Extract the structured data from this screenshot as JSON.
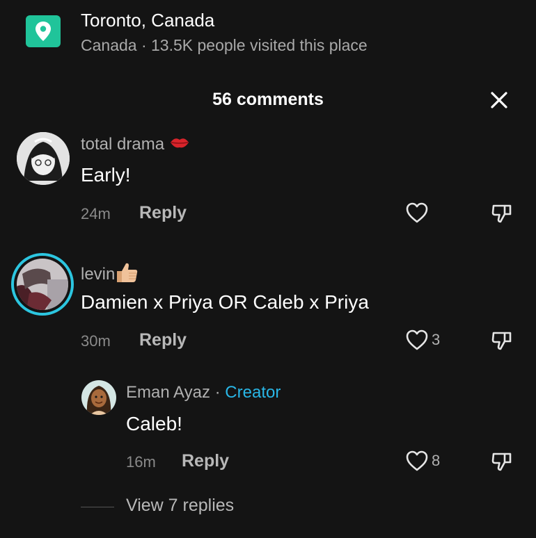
{
  "location": {
    "title": "Toronto, Canada",
    "subtitle": "Canada · 13.5K people visited this place",
    "icon": "map-pin-icon",
    "icon_color": "#20c49a"
  },
  "header": {
    "comments_count": "56 comments",
    "close_icon": "close-icon"
  },
  "comments": [
    {
      "username": "total drama",
      "emoji": "lips-emoji",
      "text": "Early!",
      "time": "24m",
      "reply_label": "Reply",
      "likes": ""
    },
    {
      "username": "levin",
      "emoji": "thumbs-up-emoji",
      "text": "Damien x Priya OR Caleb x Priya",
      "time": "30m",
      "reply_label": "Reply",
      "likes": "3",
      "avatar_ring_color": "#2cc6e0"
    }
  ],
  "reply": {
    "username": "Eman Ayaz",
    "separator": " · ",
    "badge": "Creator",
    "badge_color": "#29b6e6",
    "text": "Caleb!",
    "time": "16m",
    "reply_label": "Reply",
    "likes": "8"
  },
  "view_replies": "View 7 replies"
}
